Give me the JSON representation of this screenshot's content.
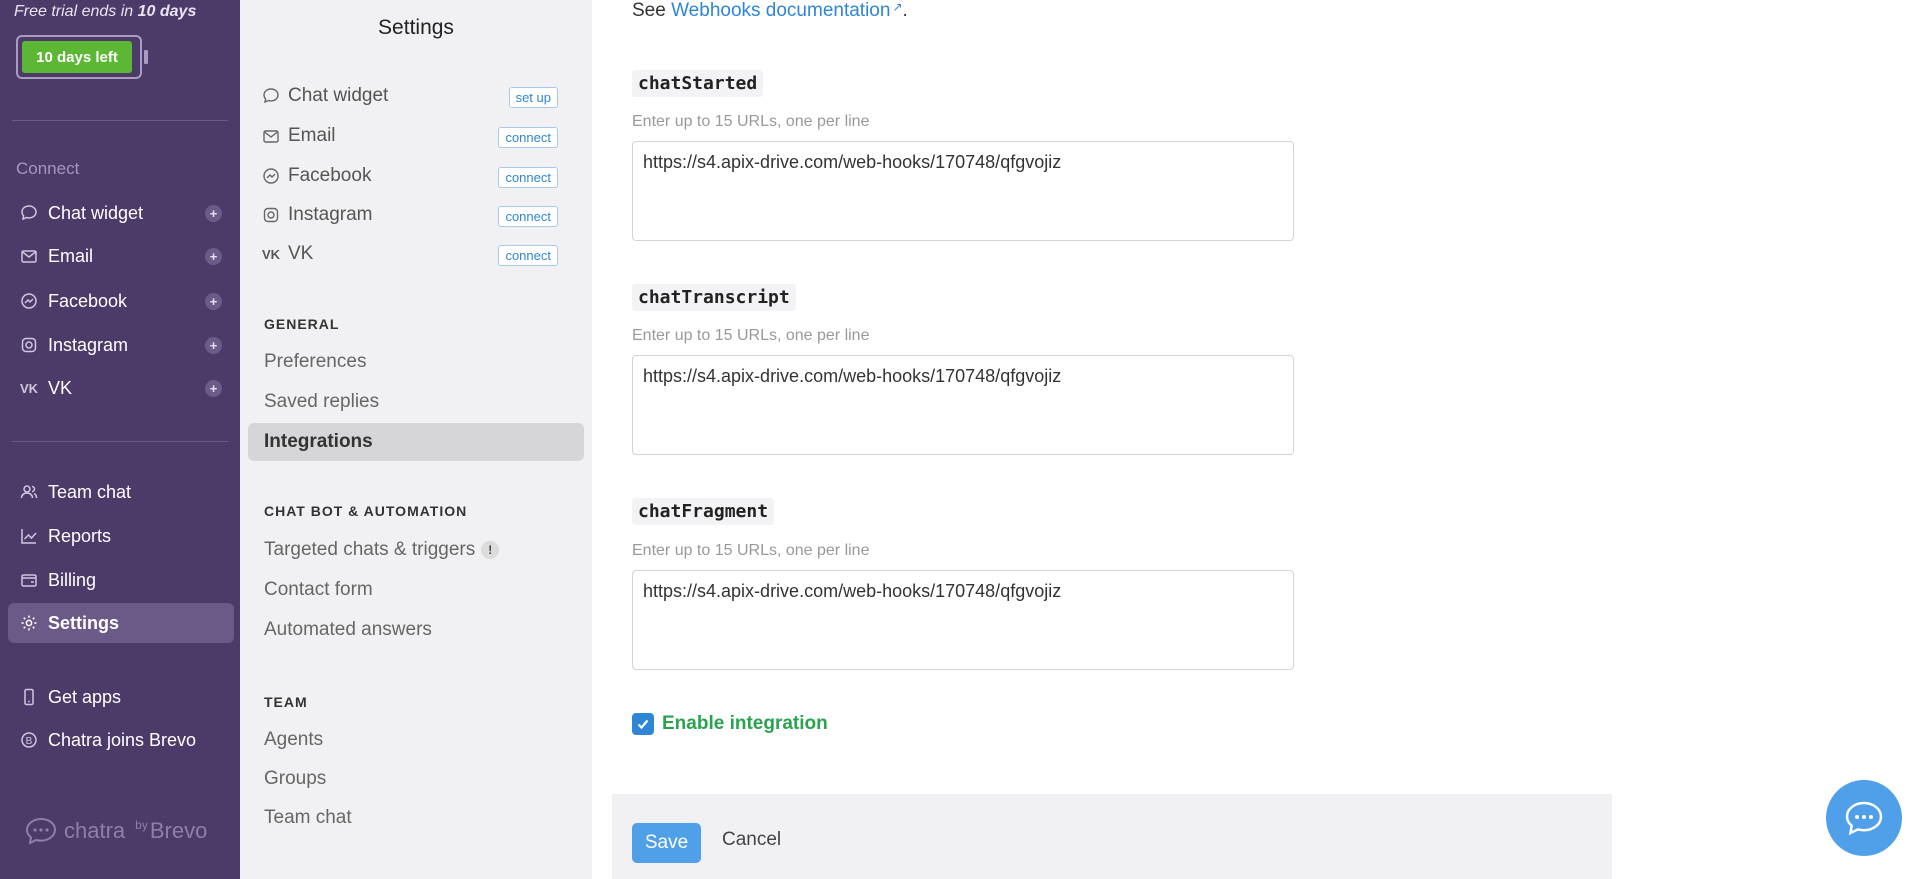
{
  "trial": {
    "prefix": "Free trial ends in",
    "days": "10 days",
    "battery_label": "10 days left"
  },
  "sidebar": {
    "connect_heading": "Connect",
    "connect_items": [
      {
        "label": "Chat widget",
        "icon": "chat-bubble-icon"
      },
      {
        "label": "Email",
        "icon": "mail-icon"
      },
      {
        "label": "Facebook",
        "icon": "messenger-icon"
      },
      {
        "label": "Instagram",
        "icon": "instagram-icon"
      },
      {
        "label": "VK",
        "icon": "vk-icon"
      }
    ],
    "nav_items": [
      {
        "label": "Team chat",
        "icon": "people-icon"
      },
      {
        "label": "Reports",
        "icon": "chart-icon"
      },
      {
        "label": "Billing",
        "icon": "wallet-icon"
      },
      {
        "label": "Settings",
        "icon": "gear-icon",
        "active": true
      }
    ],
    "extra_items": [
      {
        "label": "Get apps",
        "icon": "phone-icon"
      },
      {
        "label": "Chatra joins Brevo",
        "icon": "brevo-icon"
      }
    ],
    "brand": {
      "name": "chatra",
      "by": "by",
      "partner": "Brevo"
    }
  },
  "settings_nav": {
    "title": "Settings",
    "channels": [
      {
        "label": "Chat widget",
        "action": "set up"
      },
      {
        "label": "Email",
        "action": "connect"
      },
      {
        "label": "Facebook",
        "action": "connect"
      },
      {
        "label": "Instagram",
        "action": "connect"
      },
      {
        "label": "VK",
        "action": "connect"
      }
    ],
    "general_heading": "GENERAL",
    "general": [
      "Preferences",
      "Saved replies",
      "Integrations"
    ],
    "chatbot_heading": "CHAT BOT & AUTOMATION",
    "chatbot": [
      "Targeted chats & triggers",
      "Contact form",
      "Automated answers"
    ],
    "team_heading": "TEAM",
    "team": [
      "Agents",
      "Groups",
      "Team chat"
    ]
  },
  "main": {
    "see": "See",
    "doc_link": "Webhooks documentation",
    "webhooks": [
      {
        "event": "chatStarted",
        "hint": "Enter up to 15 URLs, one per line",
        "value": "https://s4.apix-drive.com/web-hooks/170748/qfgvojiz"
      },
      {
        "event": "chatTranscript",
        "hint": "Enter up to 15 URLs, one per line",
        "value": "https://s4.apix-drive.com/web-hooks/170748/qfgvojiz"
      },
      {
        "event": "chatFragment",
        "hint": "Enter up to 15 URLs, one per line",
        "value": "https://s4.apix-drive.com/web-hooks/170748/qfgvojiz"
      }
    ],
    "enable_label": "Enable integration",
    "enable_checked": true,
    "save_label": "Save",
    "cancel_label": "Cancel"
  },
  "colors": {
    "sidebar": "#4c3a69",
    "accent": "#4f9fe9",
    "success": "#2aa24f",
    "battery": "#5cb834"
  }
}
